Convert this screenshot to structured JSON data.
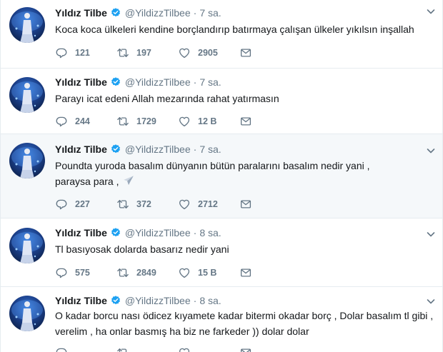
{
  "tweets": [
    {
      "name": "Yıldız Tilbe",
      "handle": "@YildizzTilbee",
      "time": "7 sa.",
      "text": "Koca koca ülkeleri kendine borçlandırıp batırmaya çalışan ülkeler  yıkılsın inşallah",
      "replies": "121",
      "retweets": "197",
      "likes": "2905"
    },
    {
      "name": "Yıldız Tilbe",
      "handle": "@YildizzTilbee",
      "time": "7 sa.",
      "text": "Parayı icat edeni Allah mezarında rahat yatırmasın",
      "replies": "244",
      "retweets": "1729",
      "likes": "12 B"
    },
    {
      "name": "Yıldız Tilbe",
      "handle": "@YildizzTilbee",
      "time": "7 sa.",
      "text": "Poundta yuroda basalım dünyanın bütün paralarını basalım nedir yani , paraysa para ,",
      "replies": "227",
      "retweets": "372",
      "likes": "2712"
    },
    {
      "name": "Yıldız Tilbe",
      "handle": "@YildizzTilbee",
      "time": "8 sa.",
      "text": "Tl basıyosak dolarda basarız nedir yani",
      "replies": "575",
      "retweets": "2849",
      "likes": "15 B"
    },
    {
      "name": "Yıldız Tilbe",
      "handle": "@YildizzTilbee",
      "time": "8 sa.",
      "text": "O kadar borcu nası ödicez kıyamete kadar bitermi okadar borç , Dolar basalım tl gibi , verelim , ha onlar basmış ha biz ne farkeder )) dolar dolar",
      "replies": "",
      "retweets": "",
      "likes": ""
    }
  ],
  "icons": {
    "reply": "reply-icon",
    "retweet": "retweet-icon",
    "like": "heart-icon",
    "dm": "envelope-icon",
    "verified": "verified-badge-icon",
    "more": "chevron-down-icon",
    "emoji": "airplane-emoji-icon"
  },
  "colors": {
    "name": "#14171a",
    "meta": "#657786",
    "verified": "#1da1f2",
    "highlight_bg": "#f5f8fa",
    "divider": "#e6ecf0"
  }
}
